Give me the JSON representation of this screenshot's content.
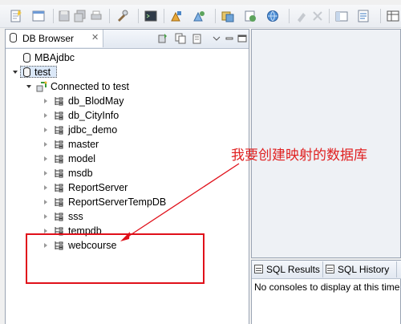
{
  "view": {
    "tab_title": "DB Browser",
    "close_glyph": "✕"
  },
  "tree": {
    "items": [
      {
        "label": "MBAjdbc",
        "type": "database"
      },
      {
        "label": "test",
        "type": "database"
      },
      {
        "label": "Connected to test",
        "type": "connection"
      },
      {
        "label": "db_BlodMay",
        "type": "schema"
      },
      {
        "label": "db_CityInfo",
        "type": "schema"
      },
      {
        "label": "jdbc_demo",
        "type": "schema"
      },
      {
        "label": "master",
        "type": "schema"
      },
      {
        "label": "model",
        "type": "schema"
      },
      {
        "label": "msdb",
        "type": "schema"
      },
      {
        "label": "ReportServer",
        "type": "schema"
      },
      {
        "label": "ReportServerTempDB",
        "type": "schema"
      },
      {
        "label": "sss",
        "type": "schema"
      },
      {
        "label": "tempdb",
        "type": "schema"
      },
      {
        "label": "webcourse",
        "type": "schema"
      }
    ]
  },
  "bottom_panel": {
    "tabs": [
      {
        "label": "SQL Results",
        "icon": "results-icon"
      },
      {
        "label": "SQL History",
        "icon": "history-icon"
      }
    ],
    "console_message": "No consoles to display at this time"
  },
  "annotation": {
    "text": "我要创建映射的数据库",
    "color": "#e02020"
  }
}
